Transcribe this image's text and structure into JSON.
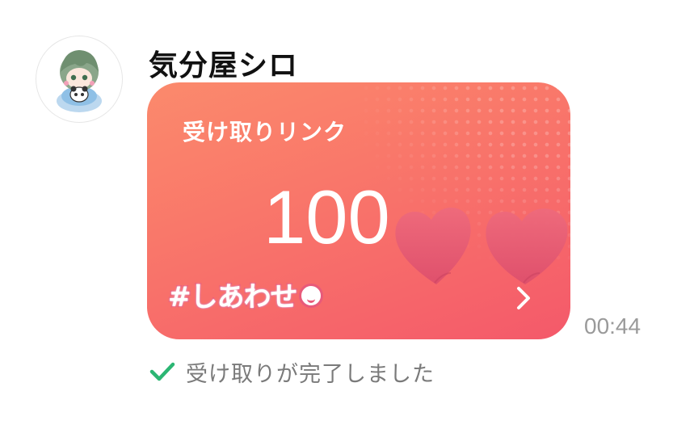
{
  "message": {
    "sender_name": "気分屋シロ",
    "avatar_icon": "user-avatar-icon",
    "timestamp": "00:44",
    "card": {
      "title": "受け取りリンク",
      "amount": "100",
      "tag": "#しあわせ",
      "open_icon": "chevron-right-icon",
      "decoration_icon": "hearts-icon",
      "colors": {
        "gradient_start": "#fb8a6c",
        "gradient_end": "#f4596a",
        "heart": "#e65a74"
      }
    },
    "status": {
      "icon": "check-icon",
      "text": "受け取りが完了しました",
      "color": "#2bb673"
    }
  }
}
